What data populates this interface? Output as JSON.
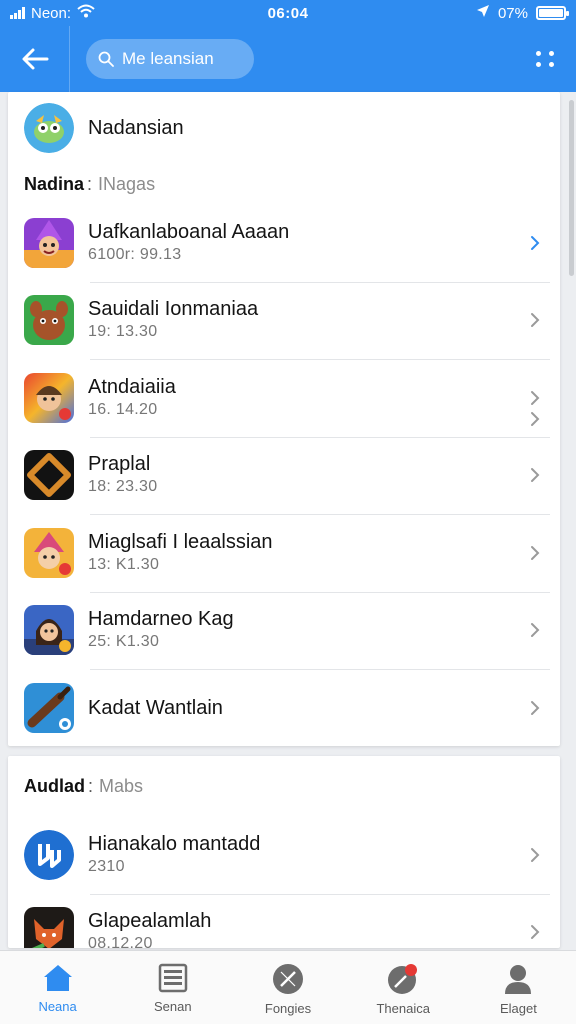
{
  "status_bar": {
    "carrier": "Neon:",
    "time": "06:04",
    "battery": "07%"
  },
  "header": {
    "search_text": "Me leansian"
  },
  "top_item": {
    "label": "Nadansian"
  },
  "section1": {
    "title": "Nadina",
    "subtitle": "INagas"
  },
  "apps": [
    {
      "name": "Uafkanlaboanal Aaaan",
      "meta": "6100r: 99.13",
      "chevron_color": "#2f8cf0"
    },
    {
      "name": "Sauidali Ionmaniaa",
      "meta": "19: 13.30",
      "chevron_color": "#9a9a9a"
    },
    {
      "name": "Atndaiaiia",
      "meta": "16. 14.20",
      "chevron_color": "#9a9a9a"
    },
    {
      "name": "Praplal",
      "meta": "18: 23.30",
      "chevron_color": "#9a9a9a"
    },
    {
      "name": "Miaglsafi I leaalssian",
      "meta": "13: K1.30",
      "chevron_color": "#9a9a9a"
    },
    {
      "name": "Hamdarneo Kag",
      "meta": "25: K1.30",
      "chevron_color": "#9a9a9a"
    },
    {
      "name": "Kadat Wantlain",
      "meta": "",
      "chevron_color": "#9a9a9a"
    }
  ],
  "section2": {
    "title": "Audlad",
    "subtitle": "Mabs"
  },
  "apps2": [
    {
      "name": "Hianakalo mantadd",
      "meta": "2310"
    },
    {
      "name": "Glapealamlah",
      "meta": "08.12.20"
    }
  ],
  "bottom_nav": [
    {
      "label": "Neana",
      "icon": "home-icon",
      "active": true
    },
    {
      "label": "Senan",
      "icon": "list-icon",
      "active": false
    },
    {
      "label": "Fongies",
      "icon": "compass-icon",
      "active": false
    },
    {
      "label": "Thenaica",
      "icon": "notification-icon",
      "active": false
    },
    {
      "label": "Elaget",
      "icon": "profile-icon",
      "active": false
    }
  ],
  "colors": {
    "primary": "#2f8cf0",
    "badge": "#e53935"
  }
}
